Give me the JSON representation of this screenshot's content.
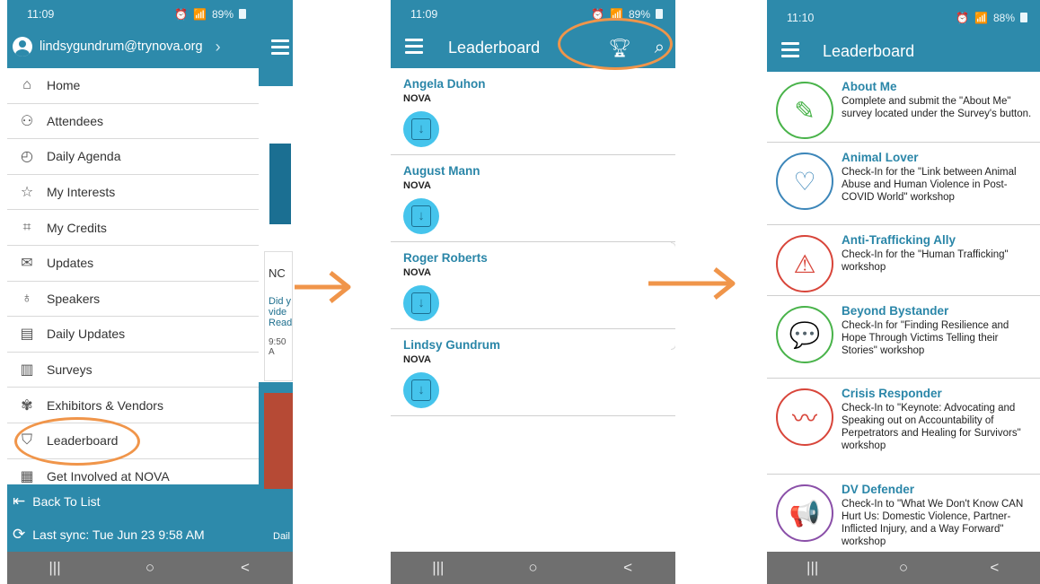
{
  "phone1": {
    "status_time": "11:09",
    "status_battery": "89%",
    "account_email": "lindsygundrum@trynova.org",
    "menu_items": [
      {
        "label": "Home",
        "icon": "⌂"
      },
      {
        "label": "Attendees",
        "icon": "⚇"
      },
      {
        "label": "Daily Agenda",
        "icon": "◴"
      },
      {
        "label": "My Interests",
        "icon": "☆"
      },
      {
        "label": "My Credits",
        "icon": "⌗"
      },
      {
        "label": "Updates",
        "icon": "✉"
      },
      {
        "label": "Speakers",
        "icon": "♁"
      },
      {
        "label": "Daily Updates",
        "icon": "▤"
      },
      {
        "label": "Surveys",
        "icon": "▥"
      },
      {
        "label": "Exhibitors & Vendors",
        "icon": "✾"
      },
      {
        "label": "Leaderboard",
        "icon": "⛉"
      },
      {
        "label": "Get Involved at NOVA",
        "icon": "▦"
      }
    ],
    "back_to_list": "Back To List",
    "last_sync": "Last sync: Tue Jun 23 9:58 AM",
    "peek_card_text": [
      "NC",
      "Did y",
      "vide",
      "Read",
      "9:50 A"
    ],
    "peek_bottom": "Dail"
  },
  "phone2": {
    "status_time": "11:09",
    "status_battery": "89%",
    "title": "Leaderboard",
    "entries": [
      {
        "name": "Angela Duhon",
        "org": "NOVA"
      },
      {
        "name": "August Mann",
        "org": "NOVA"
      },
      {
        "name": "Roger Roberts",
        "org": "NOVA"
      },
      {
        "name": "Lindsy Gundrum",
        "org": "NOVA"
      }
    ]
  },
  "phone3": {
    "status_time": "11:10",
    "status_battery": "88%",
    "title": "Leaderboard",
    "badges": [
      {
        "title": "About Me",
        "desc": "Complete and submit the \"About Me\" survey located under the Survey's button.",
        "color": "#49b34a",
        "icon": "✎"
      },
      {
        "title": "Animal Lover",
        "desc": "Check-In for the \"Link between Animal Abuse and Human Violence in Post-COVID World\" workshop",
        "color": "#3c86b9",
        "icon": "♡"
      },
      {
        "title": "Anti-Trafficking Ally",
        "desc": "Check-In for the \"Human Trafficking\" workshop",
        "color": "#d8453a",
        "icon": "⚠"
      },
      {
        "title": "Beyond Bystander",
        "desc": "Check-In for \"Finding Resilience and Hope Through Victims Telling their Stories\" workshop",
        "color": "#49b34a",
        "icon": "💬"
      },
      {
        "title": "Crisis Responder",
        "desc": "Check-In to \"Keynote: Advocating and Speaking out on Accountability of Perpetrators and Healing for Survivors\" workshop",
        "color": "#d8453a",
        "icon": "〰"
      },
      {
        "title": "DV Defender",
        "desc": "Check-In to \"What We Don't Know CAN Hurt Us: Domestic Violence, Partner-Inflicted Injury, and a Way Forward\" workshop",
        "color": "#8a4fa8",
        "icon": "📢"
      }
    ]
  },
  "nav_buttons": [
    "|||",
    "○",
    "<"
  ],
  "colors": {
    "primary": "#2d8aab",
    "highlight": "#f0954a",
    "accent_button": "#45c4ec"
  }
}
